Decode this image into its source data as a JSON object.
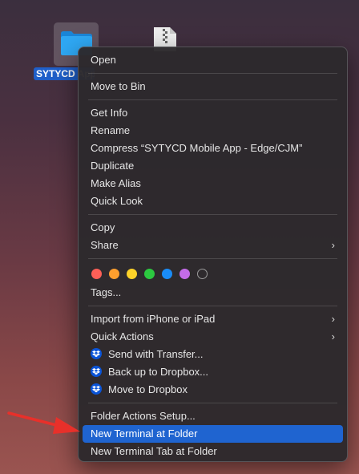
{
  "desktop": {
    "folder_label": "SYTYCD App - Edge/CJM",
    "folder_color": "#1e9bf0",
    "selection_color": "#1f5fc9"
  },
  "menu": {
    "open": "Open",
    "move_to_bin": "Move to Bin",
    "get_info": "Get Info",
    "rename": "Rename",
    "compress": "Compress “SYTYCD Mobile App - Edge/CJM”",
    "duplicate": "Duplicate",
    "make_alias": "Make Alias",
    "quick_look": "Quick Look",
    "copy": "Copy",
    "share": "Share",
    "tags": "Tags...",
    "import_iphone": "Import from iPhone or iPad",
    "quick_actions": "Quick Actions",
    "send_with_transfer": "Send with Transfer...",
    "back_up_dropbox": "Back up to Dropbox...",
    "move_to_dropbox": "Move to Dropbox",
    "folder_actions_setup": "Folder Actions Setup...",
    "new_terminal_at_folder": "New Terminal at Folder",
    "new_terminal_tab_at_folder": "New Terminal Tab at Folder",
    "submenu_icon": "chevron-right-icon",
    "dropbox_icon": "dropbox-icon",
    "selected_item": "New Terminal at Folder",
    "highlight_color": "#1f64d0"
  },
  "tag_colors": [
    {
      "name": "red",
      "color": "#fe5f57"
    },
    {
      "name": "orange",
      "color": "#fe9f2e"
    },
    {
      "name": "yellow",
      "color": "#fdd229"
    },
    {
      "name": "green",
      "color": "#2cc840"
    },
    {
      "name": "blue",
      "color": "#1a8cf7"
    },
    {
      "name": "purple",
      "color": "#c46ce8"
    },
    {
      "name": "gray",
      "color": "none"
    }
  ],
  "annotation": {
    "arrow_color": "#e8302a"
  }
}
